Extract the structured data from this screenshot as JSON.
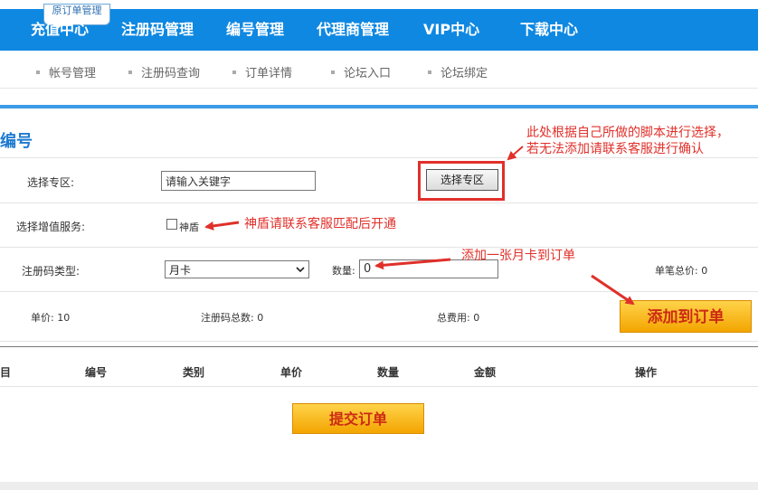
{
  "nav": {
    "bubble_label": "原订单管理",
    "items": [
      {
        "label": "充值中心"
      },
      {
        "label": "注册码管理"
      },
      {
        "label": "编号管理"
      },
      {
        "label": "代理商管理"
      },
      {
        "label": "VIP中心"
      },
      {
        "label": "下载中心"
      }
    ]
  },
  "subnav": {
    "items": [
      {
        "label": "帐号管理"
      },
      {
        "label": "注册码查询"
      },
      {
        "label": "订单详情"
      },
      {
        "label": "论坛入口"
      },
      {
        "label": "论坛绑定"
      }
    ]
  },
  "section": {
    "title": "编号"
  },
  "form": {
    "zone_label": "选择专区:",
    "zone_input_value": "请输入关键字",
    "zone_button": "选择专区",
    "addon_label": "选择增值服务:",
    "addon_option": "神盾",
    "type_label": "注册码类型:",
    "type_selected": "月卡",
    "qty_label": "数量:",
    "qty_value": "0",
    "single_total_label": "单笔总价:",
    "single_total_value": "0",
    "unit_price_label": "单价:",
    "unit_price_value": "10",
    "code_total_label": "注册码总数:",
    "code_total_value": "0",
    "total_cost_label": "总费用:",
    "total_cost_value": "0",
    "add_button": "添加到订单"
  },
  "annotations": {
    "zone_note": "此处根据自己所做的脚本进行选择，若无法添加请联系客服进行确认",
    "addon_note": "神盾请联系客服匹配后开通",
    "qty_note": "添加一张月卡到订单"
  },
  "table": {
    "headers": [
      "目",
      "编号",
      "类别",
      "单价",
      "数量",
      "金额",
      "操作"
    ]
  },
  "submit_button": "提交订单",
  "colors": {
    "nav_blue": "#0f88e2",
    "accent_blue": "#1e7ad0",
    "annotation_red": "#e0302a",
    "button_orange": "#f3a500"
  }
}
